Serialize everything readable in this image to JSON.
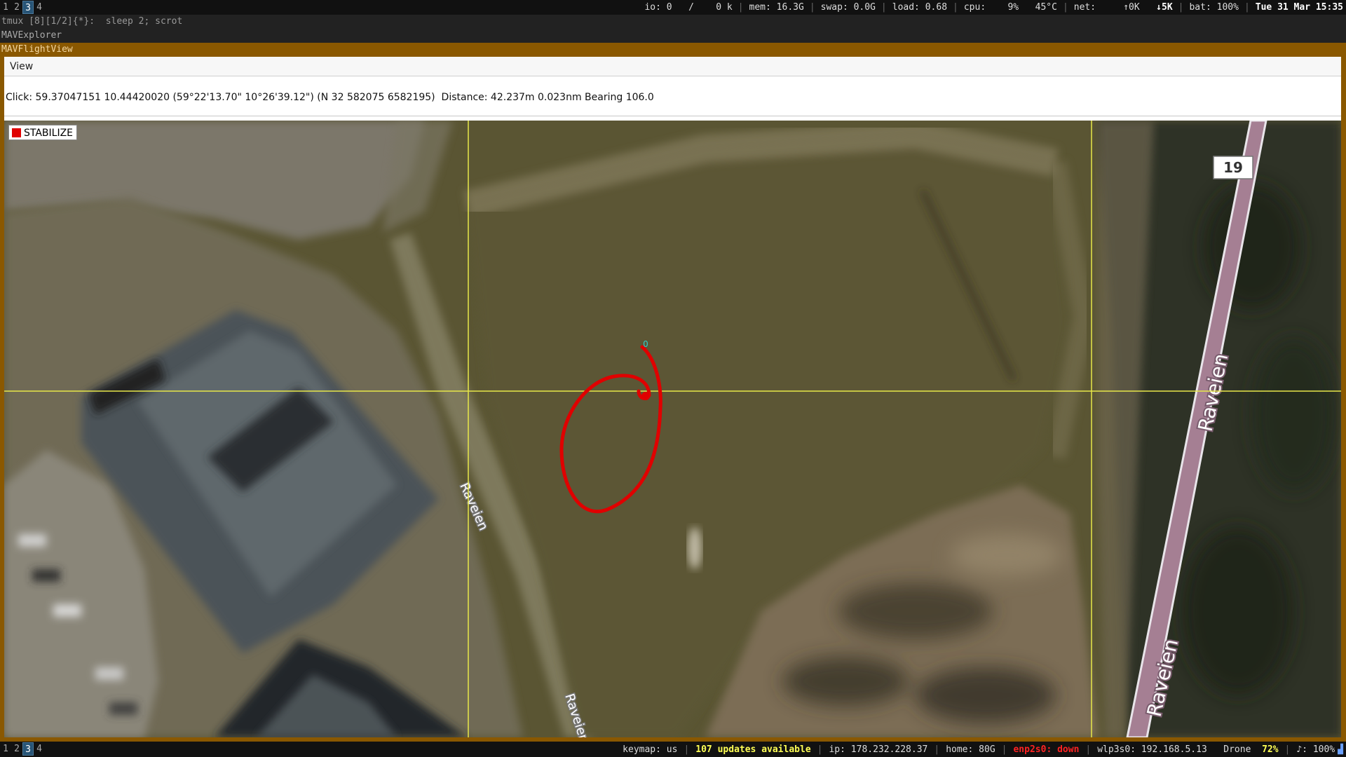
{
  "topbar": {
    "workspaces": [
      "1",
      "2",
      "3",
      "4"
    ],
    "active_workspace": "3",
    "io": "io: 0",
    "io_rate": "/    0 k",
    "mem": "mem: 16.3G",
    "swap": "swap: 0.0G",
    "load": "load: 0.68",
    "cpu": "cpu:    9%",
    "temp": "45°C",
    "net": "net:     ↑0K",
    "net_down": "↓5K",
    "bat": "bat: 100%",
    "clock": "Tue 31 Mar 15:35"
  },
  "terminal": {
    "line1": "tmux [8][1/2]{*}:  sleep 2; scrot",
    "line2": "MAVExplorer",
    "line3": "MAVFlightView"
  },
  "app": {
    "menu": {
      "view": "View"
    },
    "click_info": "Click: 59.37047151 10.44420020 (59°22'13.70\" 10°26'39.12\") (N 32 582075 6582195)  Distance: 42.237m 0.023nm Bearing 106.0",
    "mode_label": "STABILIZE",
    "map": {
      "road_labels": [
        "Raveien",
        "Raveien",
        "Raveien",
        "Raveien"
      ],
      "route_badge": "19",
      "waypoint_label": "0",
      "colors": {
        "track": "#e00000",
        "grid": "#e8e84a",
        "waypoint": "#33cccc"
      }
    }
  },
  "bottombar": {
    "workspaces": [
      "1",
      "2",
      "3",
      "4"
    ],
    "active_workspace": "3",
    "keymap": "keymap: us",
    "updates": "107 updates available",
    "ip": "ip: 178.232.228.37",
    "home": "home: 80G",
    "eth": "enp2s0: down",
    "wlan": "wlp3s0: 192.168.5.13",
    "ssid": "Drone",
    "wifi_quality": "72%",
    "volume": "♪: 100%"
  }
}
